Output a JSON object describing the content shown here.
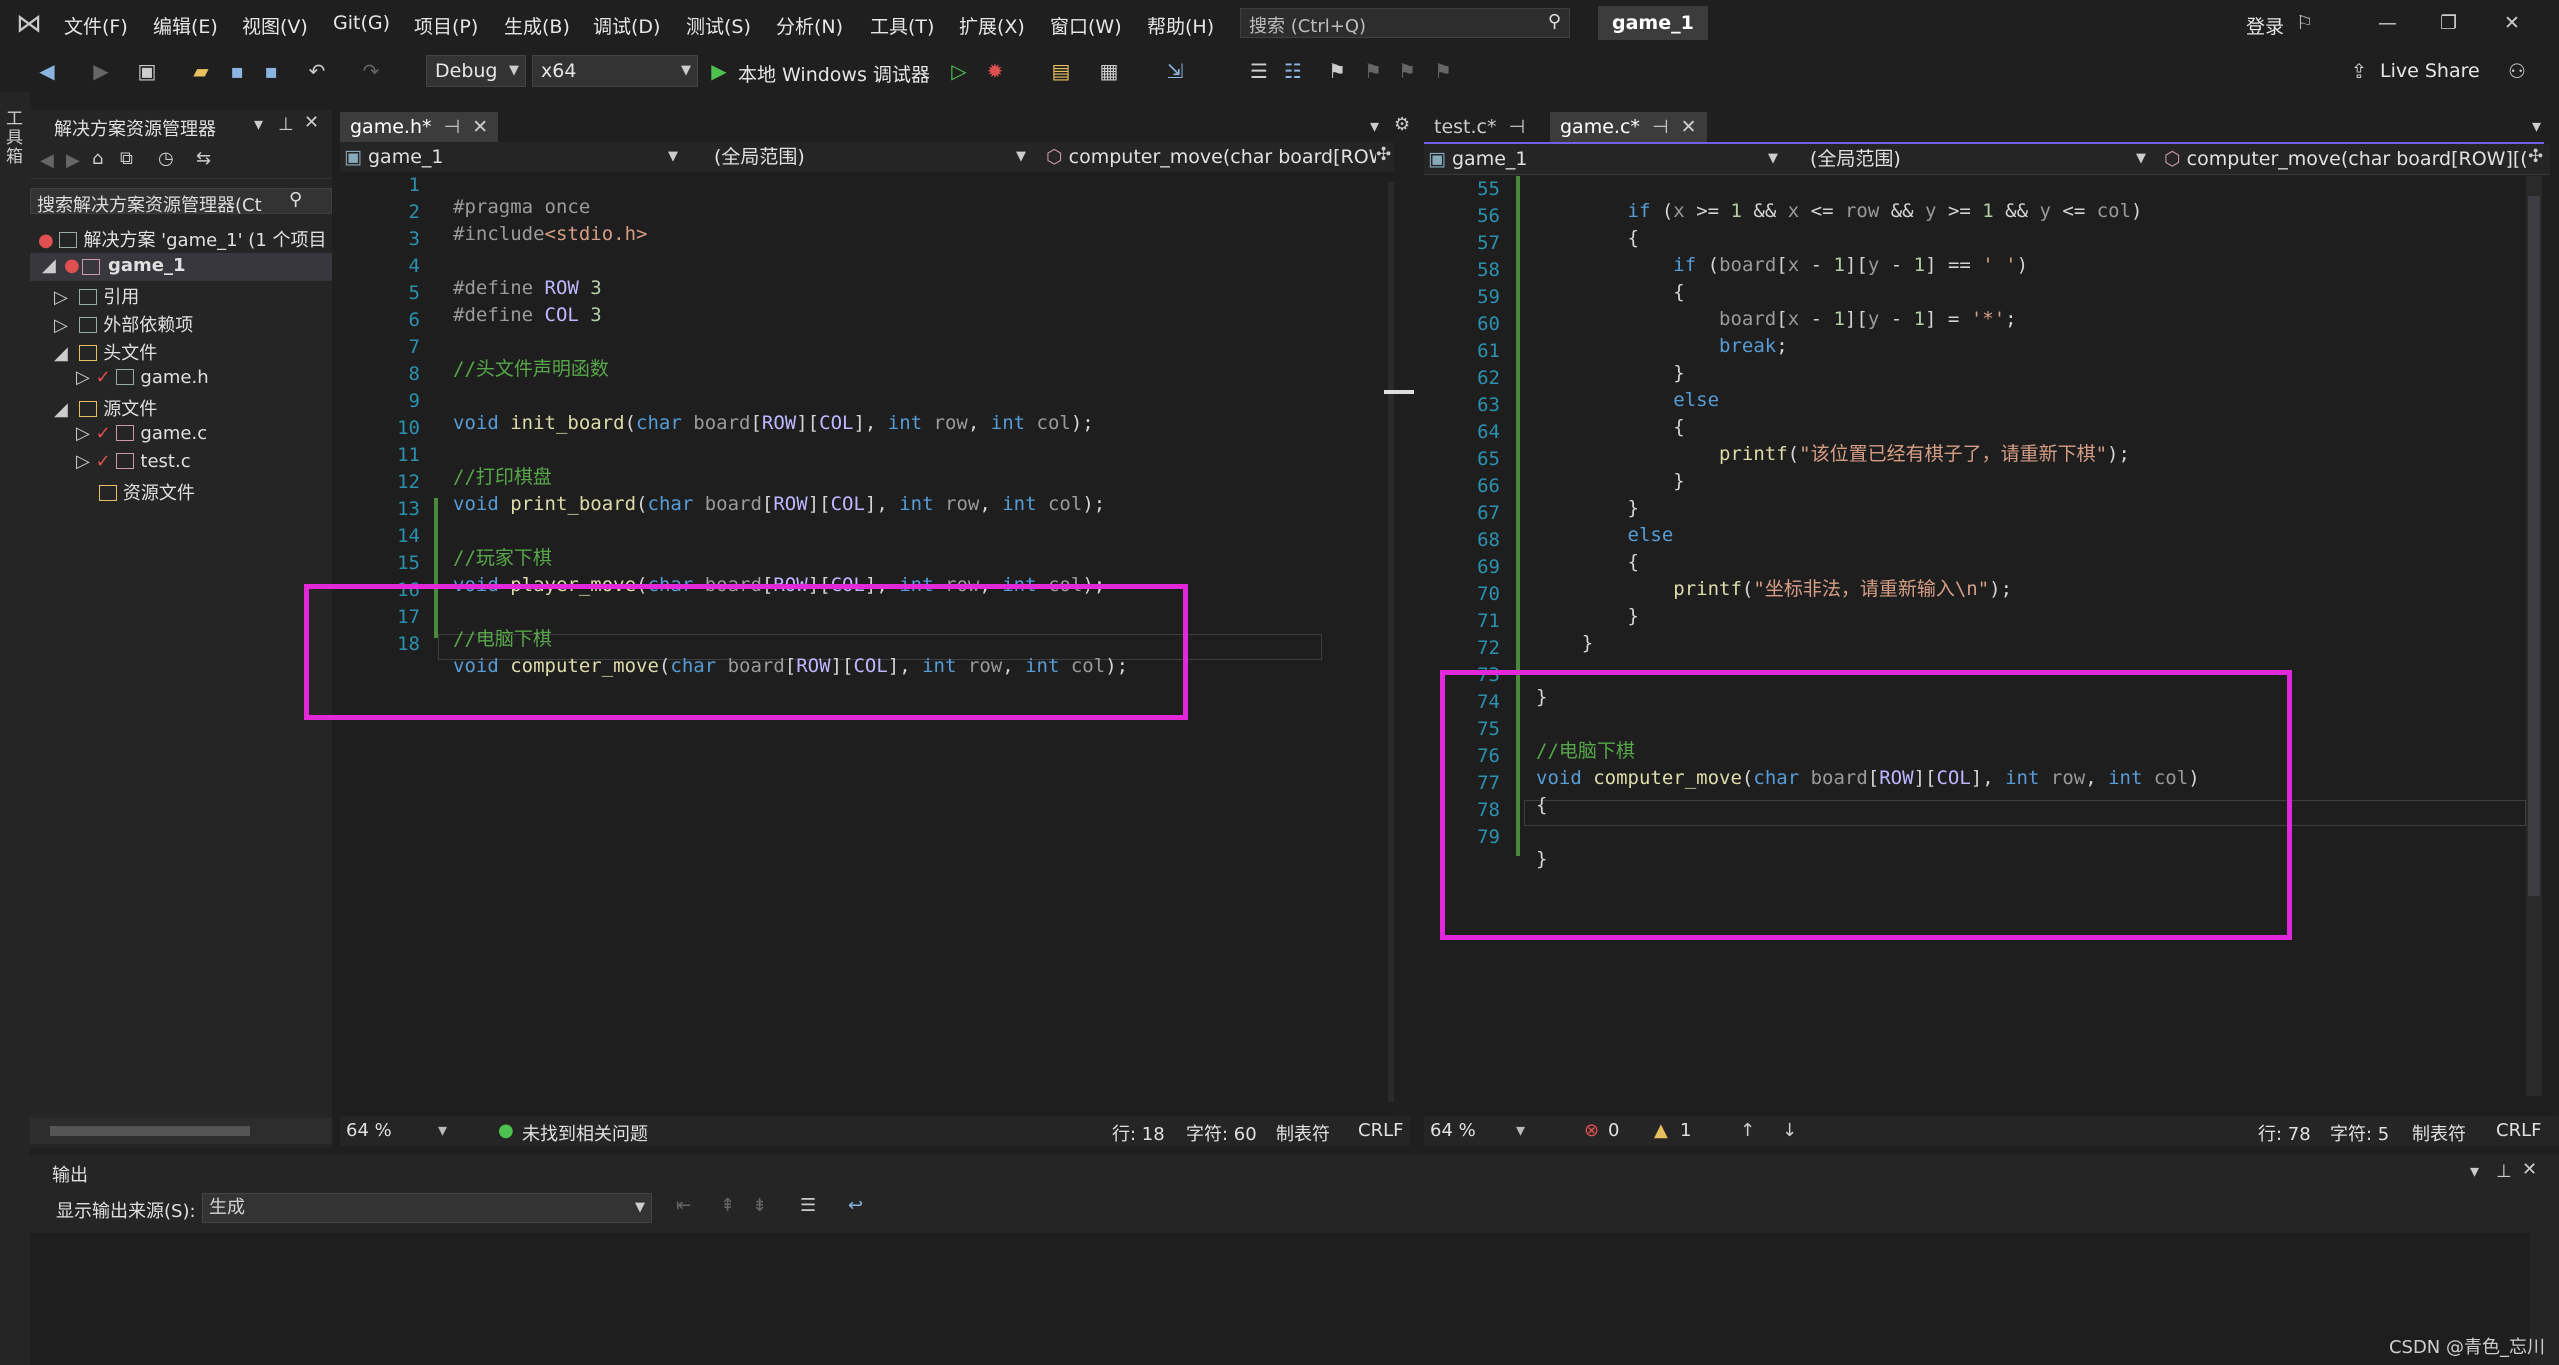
{
  "menu": {
    "items": [
      "文件(F)",
      "编辑(E)",
      "视图(V)",
      "Git(G)",
      "项目(P)",
      "生成(B)",
      "调试(D)",
      "测试(S)",
      "分析(N)",
      "工具(T)",
      "扩展(X)",
      "窗口(W)",
      "帮助(H)"
    ],
    "search_placeholder": "搜索 (Ctrl+Q)",
    "solution_name": "game_1",
    "login": "登录"
  },
  "toolbar": {
    "config": "Debug",
    "platform": "x64",
    "run_label": "本地 Windows 调试器",
    "live_share": "Live Share"
  },
  "left_strip": {
    "label": "工具箱"
  },
  "solution_explorer": {
    "title": "解决方案资源管理器",
    "search_placeholder": "搜索解决方案资源管理器(Ct",
    "items": [
      {
        "label": "解决方案 'game_1' (1 个项目"
      },
      {
        "label": "game_1"
      },
      {
        "label": "引用"
      },
      {
        "label": "外部依赖项"
      },
      {
        "label": "头文件"
      },
      {
        "label": "game.h"
      },
      {
        "label": "源文件"
      },
      {
        "label": "game.c"
      },
      {
        "label": "test.c"
      },
      {
        "label": "资源文件"
      }
    ]
  },
  "left_editor": {
    "tab": "game.h*",
    "nav_project": "game_1",
    "nav_scope": "(全局范围)",
    "nav_member": "computer_move(char board[ROW",
    "lines": [
      "1",
      "2",
      "3",
      "4",
      "5",
      "6",
      "7",
      "8",
      "9",
      "10",
      "11",
      "12",
      "13",
      "14",
      "15",
      "16",
      "17",
      "18"
    ],
    "comment_header": "//头文件声明函数",
    "comment_print": "//打印棋盘",
    "comment_player": "//玩家下棋",
    "comment_computer": "//电脑下棋",
    "status": {
      "zoom": "64 %",
      "issues": "未找到相关问题",
      "line": "行: 18",
      "char": "字符: 60",
      "tabs": "制表符",
      "eol": "CRLF"
    }
  },
  "right_editor": {
    "tab_inactive": "test.c*",
    "tab_active": "game.c*",
    "nav_project": "game_1",
    "nav_scope": "(全局范围)",
    "nav_member": "computer_move(char board[ROW][(",
    "lines": [
      "55",
      "56",
      "57",
      "58",
      "59",
      "60",
      "61",
      "62",
      "63",
      "64",
      "65",
      "66",
      "67",
      "68",
      "69",
      "70",
      "71",
      "72",
      "73",
      "74",
      "75",
      "76",
      "77",
      "78",
      "79"
    ],
    "string_occupied": "\"该位置已经有棋子了，请重新下棋\"",
    "string_invalid": "\"坐标非法，请重新输入\\n\"",
    "comment_computer": "//电脑下棋",
    "status": {
      "zoom": "64 %",
      "errors": "0",
      "warnings": "1",
      "line": "行: 78",
      "char": "字符: 5",
      "tabs": "制表符",
      "eol": "CRLF"
    }
  },
  "output": {
    "title": "输出",
    "source_label": "显示输出来源(S):",
    "source_value": "生成"
  },
  "watermark": "CSDN @青色_忘川",
  "colors": {
    "highlight": "#e328d9",
    "accent_tab": "#7160e8"
  }
}
